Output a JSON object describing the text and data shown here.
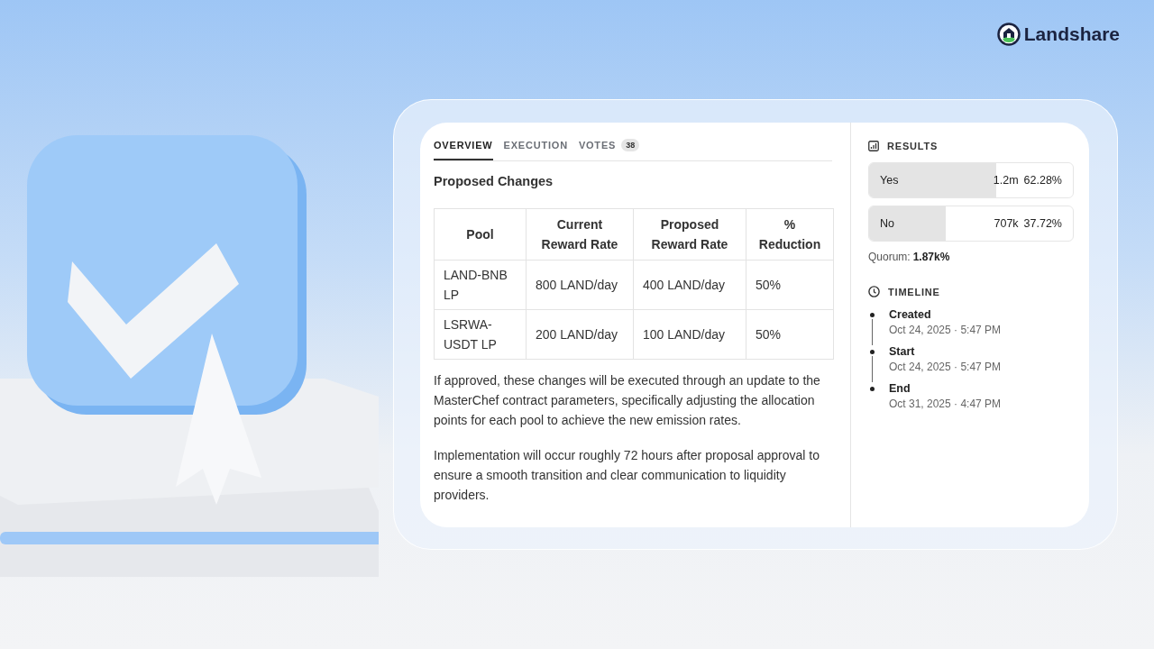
{
  "brand": {
    "name": "Landshare"
  },
  "tabs": [
    {
      "label": "OVERVIEW",
      "selected": true
    },
    {
      "label": "EXECUTION",
      "selected": false
    },
    {
      "label": "VOTES",
      "selected": false,
      "count": "38"
    }
  ],
  "section_title": "Proposed Changes",
  "table": {
    "columns": [
      "Pool",
      "Current Reward Rate",
      "Proposed Reward Rate",
      "% Reduction"
    ],
    "rows": [
      [
        "LAND-BNB LP",
        "800 LAND/day",
        "400 LAND/day",
        "50%"
      ],
      [
        "LSRWA-USDT LP",
        "200 LAND/day",
        "100 LAND/day",
        "50%"
      ]
    ]
  },
  "paragraphs": [
    "If approved, these changes will be executed through an update to the MasterChef contract parameters, specifically adjusting the allocation points for each pool to achieve the new emission rates.",
    "Implementation will occur roughly 72 hours after proposal approval to ensure a smooth transition and clear communication to liquidity providers."
  ],
  "results": {
    "title": "RESULTS",
    "options": [
      {
        "label": "Yes",
        "amount": "1.2m",
        "percent": "62.28%",
        "level": 0.6228
      },
      {
        "label": "No",
        "amount": "707k",
        "percent": "37.72%",
        "level": 0.3772
      }
    ],
    "quorum_label": "Quorum:",
    "quorum_value": "1.87k%"
  },
  "timeline": {
    "title": "TIMELINE",
    "events": [
      {
        "label": "Created",
        "time": "Oct 24, 2025 · 5:47 PM"
      },
      {
        "label": "Start",
        "time": "Oct 24, 2025 · 5:47 PM"
      },
      {
        "label": "End",
        "time": "Oct 31, 2025 · 4:47 PM"
      }
    ]
  }
}
